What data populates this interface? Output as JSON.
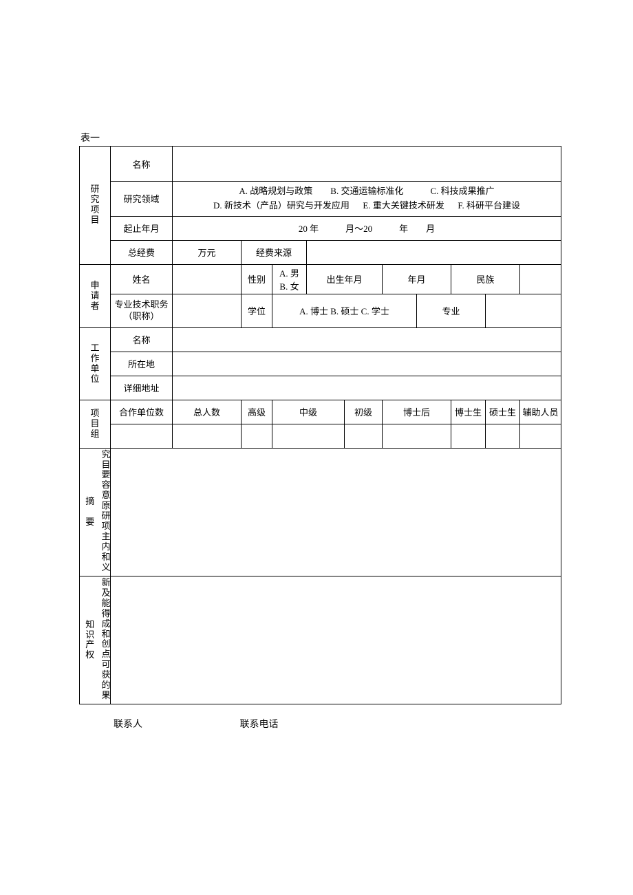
{
  "title": "表一",
  "section_project": "研究项目",
  "project": {
    "name_label": "名称",
    "domain_label": "研究领域",
    "domain_opt_a": "A. 战略规划与政策",
    "domain_opt_b": "B. 交通运输标准化",
    "domain_opt_c": "C. 科技成果推广",
    "domain_opt_d": "D. 新技术（产品）研究与开发应用",
    "domain_opt_e": "E. 重大关键技术研发",
    "domain_opt_f": "F. 科研平台建设",
    "period_label": "起止年月",
    "period_value": "20 年   月～20   年  月",
    "budget_label": "总经费",
    "budget_value": "万元",
    "budget_source_label": "经费来源"
  },
  "section_applicant": "申请者",
  "applicant": {
    "name_label": "姓名",
    "gender_label": "性别",
    "gender_a": "A. 男",
    "gender_b": "B. 女",
    "birth_label": "出生年月",
    "birth_value": "年月",
    "ethnic_label": "民族",
    "title_label_l1": "专业技术职务",
    "title_label_l2": "（职称）",
    "degree_label": "学位",
    "degree_opts": "A. 博士 B. 硕士 C. 学士",
    "major_label": "专业"
  },
  "section_workunit": "工作单位",
  "workunit": {
    "name_label": "名称",
    "location_label": "所在地",
    "address_label": "详细地址"
  },
  "section_group": "项目组",
  "group": {
    "coop_label": "合作单位数",
    "total_label": "总人数",
    "senior_label": "高级",
    "mid_label": "中级",
    "junior_label": "初级",
    "postdoc_label": "博士后",
    "phd_label": "博士生",
    "master_label": "硕士生",
    "assist_label": "辅助人员"
  },
  "section_summary_outer": "摘  要",
  "section_summary_col": "究目要容意",
  "section_summary_col2": "原研项主内和义",
  "section_innov_outer": "知识产权",
  "section_innov_col": "新及能得成和",
  "section_innov_col2": "创点可获的果",
  "footer": {
    "contact_label": "联系人",
    "phone_label": "联系电话"
  }
}
